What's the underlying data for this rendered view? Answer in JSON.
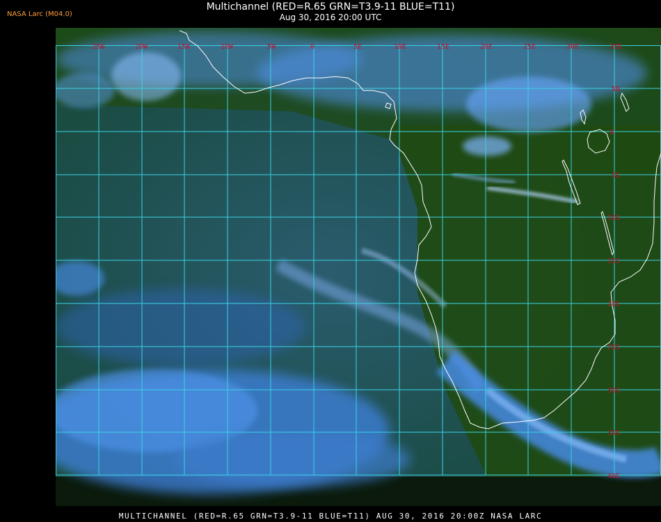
{
  "header": {
    "credit": "NASA Larc (M04.0)",
    "title": "Multichannel (RED=R.65 GRN=T3.9-11 BLUE=T11)",
    "subtitle": "Aug 30, 2016 20:00 UTC"
  },
  "map": {
    "longitude_labels": [
      "25W",
      "20W",
      "15W",
      "10W",
      "5W",
      "0",
      "5E",
      "10E",
      "15E",
      "20E",
      "25E",
      "30E",
      "35E"
    ],
    "latitude_labels": [
      "5N",
      "0",
      "5S",
      "10S",
      "15S",
      "20S",
      "25S",
      "30S",
      "35S",
      "40S"
    ],
    "colors": {
      "land": "#1f4a12",
      "ocean": "#1d4f3a",
      "cloud": "#5aa0ff",
      "cloud_bright": "#b9d8ff",
      "grid": "#39d3e6",
      "coastline": "#ffffff",
      "label": "#c8102e"
    }
  },
  "footer": {
    "caption": "MULTICHANNEL (RED=R.65 GRN=T3.9-11 BLUE=T11) AUG 30, 2016 20:00Z   NASA LARC"
  }
}
